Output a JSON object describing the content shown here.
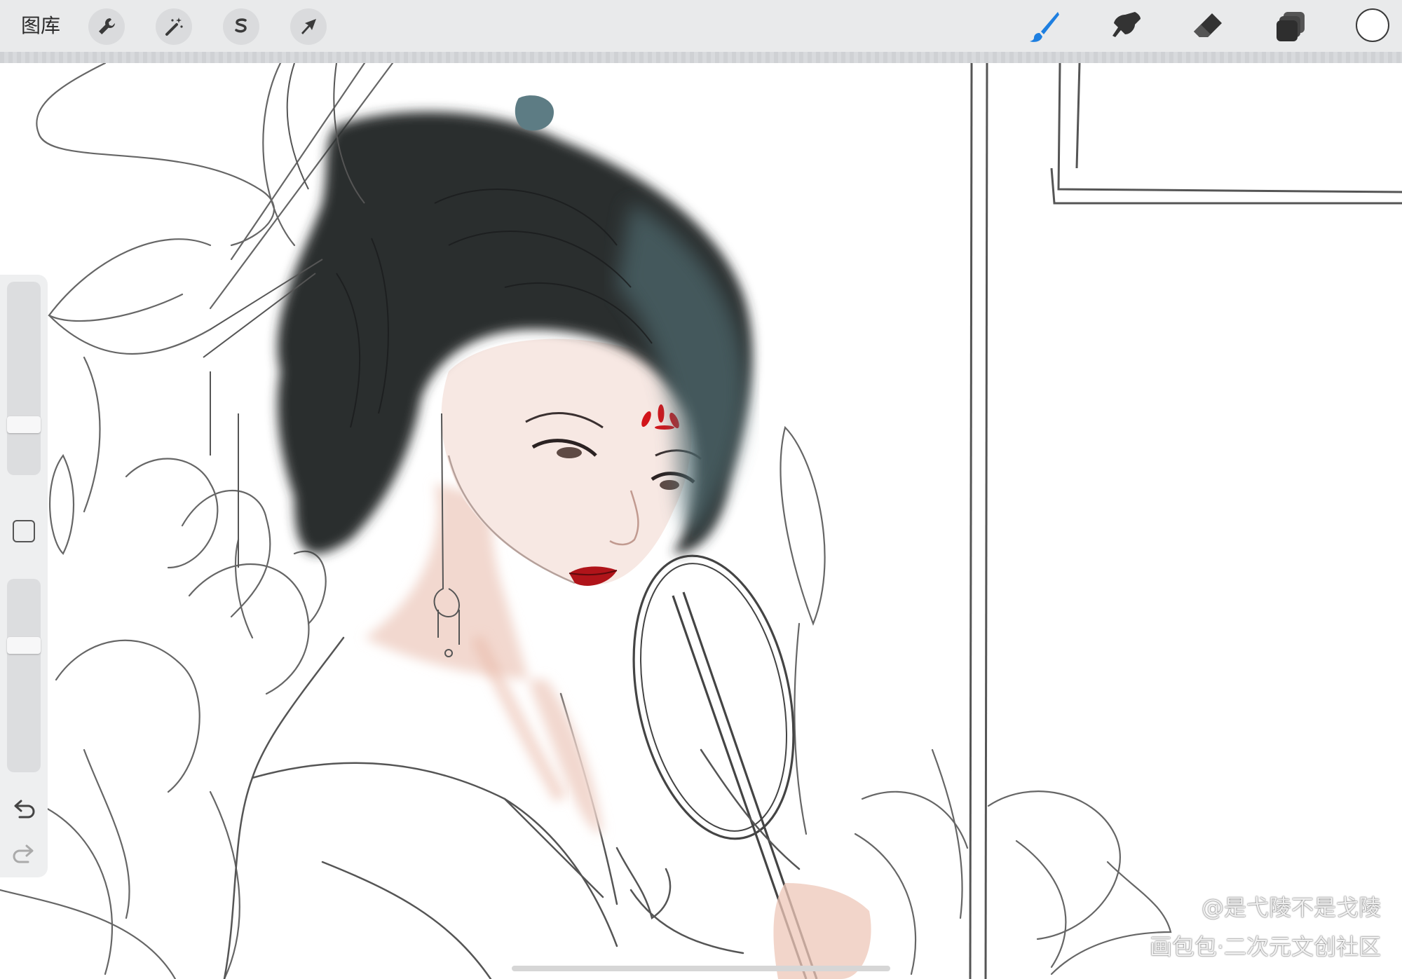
{
  "toolbar": {
    "gallery_label": "图库",
    "left_tools": [
      {
        "icon": "wrench-icon",
        "name": "actions"
      },
      {
        "icon": "magic-wand-icon",
        "name": "adjustments"
      },
      {
        "icon": "selection-s-icon",
        "name": "selection"
      },
      {
        "icon": "arrow-cursor-icon",
        "name": "transform"
      }
    ],
    "right_tools": [
      {
        "icon": "paintbrush-icon",
        "name": "brush",
        "active": true
      },
      {
        "icon": "smudge-icon",
        "name": "smudge"
      },
      {
        "icon": "eraser-icon",
        "name": "eraser"
      },
      {
        "icon": "layers-icon",
        "name": "layers"
      }
    ],
    "current_color": "#ffffff",
    "accent_color": "#1e7fe0"
  },
  "sidebar": {
    "brush_size_level": 0.24,
    "opacity_level": 0.67,
    "modify_button": "square-icon",
    "undo_icon": "undo-icon",
    "redo_icon": "redo-icon"
  },
  "watermark": {
    "line1": "@是弋陵不是戈陵",
    "line2": "画包包·二次元文创社区"
  },
  "artwork": {
    "subject": "ink-style illustration of a woman with hair bun and round fan",
    "hair_color": "#2a2d2e",
    "hair_tint": "#4f6a70",
    "skin_color": "#f6e6e0",
    "lip_color": "#b0141a",
    "forehead_mark_color": "#d2141a"
  }
}
